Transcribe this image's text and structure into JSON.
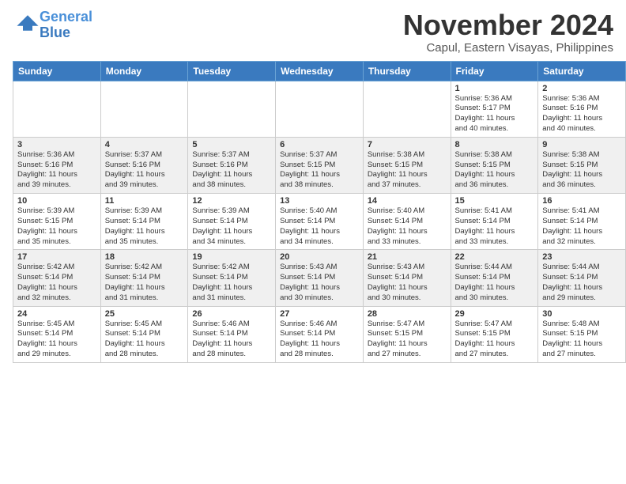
{
  "header": {
    "logo_line1": "General",
    "logo_line2": "Blue",
    "title": "November 2024",
    "subtitle": "Capul, Eastern Visayas, Philippines"
  },
  "weekdays": [
    "Sunday",
    "Monday",
    "Tuesday",
    "Wednesday",
    "Thursday",
    "Friday",
    "Saturday"
  ],
  "weeks": [
    [
      {
        "day": "",
        "content": ""
      },
      {
        "day": "",
        "content": ""
      },
      {
        "day": "",
        "content": ""
      },
      {
        "day": "",
        "content": ""
      },
      {
        "day": "",
        "content": ""
      },
      {
        "day": "1",
        "content": "Sunrise: 5:36 AM\nSunset: 5:17 PM\nDaylight: 11 hours\nand 40 minutes."
      },
      {
        "day": "2",
        "content": "Sunrise: 5:36 AM\nSunset: 5:16 PM\nDaylight: 11 hours\nand 40 minutes."
      }
    ],
    [
      {
        "day": "3",
        "content": "Sunrise: 5:36 AM\nSunset: 5:16 PM\nDaylight: 11 hours\nand 39 minutes."
      },
      {
        "day": "4",
        "content": "Sunrise: 5:37 AM\nSunset: 5:16 PM\nDaylight: 11 hours\nand 39 minutes."
      },
      {
        "day": "5",
        "content": "Sunrise: 5:37 AM\nSunset: 5:16 PM\nDaylight: 11 hours\nand 38 minutes."
      },
      {
        "day": "6",
        "content": "Sunrise: 5:37 AM\nSunset: 5:15 PM\nDaylight: 11 hours\nand 38 minutes."
      },
      {
        "day": "7",
        "content": "Sunrise: 5:38 AM\nSunset: 5:15 PM\nDaylight: 11 hours\nand 37 minutes."
      },
      {
        "day": "8",
        "content": "Sunrise: 5:38 AM\nSunset: 5:15 PM\nDaylight: 11 hours\nand 36 minutes."
      },
      {
        "day": "9",
        "content": "Sunrise: 5:38 AM\nSunset: 5:15 PM\nDaylight: 11 hours\nand 36 minutes."
      }
    ],
    [
      {
        "day": "10",
        "content": "Sunrise: 5:39 AM\nSunset: 5:15 PM\nDaylight: 11 hours\nand 35 minutes."
      },
      {
        "day": "11",
        "content": "Sunrise: 5:39 AM\nSunset: 5:14 PM\nDaylight: 11 hours\nand 35 minutes."
      },
      {
        "day": "12",
        "content": "Sunrise: 5:39 AM\nSunset: 5:14 PM\nDaylight: 11 hours\nand 34 minutes."
      },
      {
        "day": "13",
        "content": "Sunrise: 5:40 AM\nSunset: 5:14 PM\nDaylight: 11 hours\nand 34 minutes."
      },
      {
        "day": "14",
        "content": "Sunrise: 5:40 AM\nSunset: 5:14 PM\nDaylight: 11 hours\nand 33 minutes."
      },
      {
        "day": "15",
        "content": "Sunrise: 5:41 AM\nSunset: 5:14 PM\nDaylight: 11 hours\nand 33 minutes."
      },
      {
        "day": "16",
        "content": "Sunrise: 5:41 AM\nSunset: 5:14 PM\nDaylight: 11 hours\nand 32 minutes."
      }
    ],
    [
      {
        "day": "17",
        "content": "Sunrise: 5:42 AM\nSunset: 5:14 PM\nDaylight: 11 hours\nand 32 minutes."
      },
      {
        "day": "18",
        "content": "Sunrise: 5:42 AM\nSunset: 5:14 PM\nDaylight: 11 hours\nand 31 minutes."
      },
      {
        "day": "19",
        "content": "Sunrise: 5:42 AM\nSunset: 5:14 PM\nDaylight: 11 hours\nand 31 minutes."
      },
      {
        "day": "20",
        "content": "Sunrise: 5:43 AM\nSunset: 5:14 PM\nDaylight: 11 hours\nand 30 minutes."
      },
      {
        "day": "21",
        "content": "Sunrise: 5:43 AM\nSunset: 5:14 PM\nDaylight: 11 hours\nand 30 minutes."
      },
      {
        "day": "22",
        "content": "Sunrise: 5:44 AM\nSunset: 5:14 PM\nDaylight: 11 hours\nand 30 minutes."
      },
      {
        "day": "23",
        "content": "Sunrise: 5:44 AM\nSunset: 5:14 PM\nDaylight: 11 hours\nand 29 minutes."
      }
    ],
    [
      {
        "day": "24",
        "content": "Sunrise: 5:45 AM\nSunset: 5:14 PM\nDaylight: 11 hours\nand 29 minutes."
      },
      {
        "day": "25",
        "content": "Sunrise: 5:45 AM\nSunset: 5:14 PM\nDaylight: 11 hours\nand 28 minutes."
      },
      {
        "day": "26",
        "content": "Sunrise: 5:46 AM\nSunset: 5:14 PM\nDaylight: 11 hours\nand 28 minutes."
      },
      {
        "day": "27",
        "content": "Sunrise: 5:46 AM\nSunset: 5:14 PM\nDaylight: 11 hours\nand 28 minutes."
      },
      {
        "day": "28",
        "content": "Sunrise: 5:47 AM\nSunset: 5:15 PM\nDaylight: 11 hours\nand 27 minutes."
      },
      {
        "day": "29",
        "content": "Sunrise: 5:47 AM\nSunset: 5:15 PM\nDaylight: 11 hours\nand 27 minutes."
      },
      {
        "day": "30",
        "content": "Sunrise: 5:48 AM\nSunset: 5:15 PM\nDaylight: 11 hours\nand 27 minutes."
      }
    ]
  ]
}
